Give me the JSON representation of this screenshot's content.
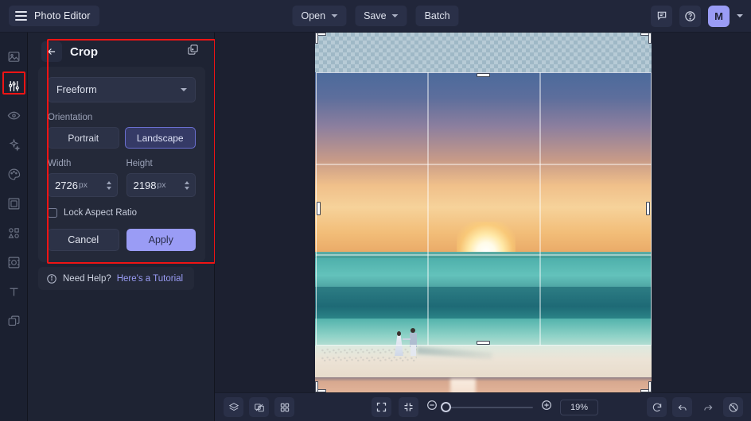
{
  "topbar": {
    "menu_icon": "hamburger-icon",
    "app_title": "Photo Editor",
    "open_label": "Open",
    "save_label": "Save",
    "batch_label": "Batch",
    "feedback_icon": "comment-icon",
    "help_icon": "question-circle-icon",
    "avatar_initial": "M",
    "avatar_caret_icon": "chevron-down-icon"
  },
  "rail": {
    "items": [
      {
        "name": "sidebar-item-image",
        "icon": "image-icon",
        "selected": false
      },
      {
        "name": "sidebar-item-adjust",
        "icon": "sliders-icon",
        "selected": true
      },
      {
        "name": "sidebar-item-retouch",
        "icon": "eye-icon",
        "selected": false
      },
      {
        "name": "sidebar-item-effects",
        "icon": "sparkles-icon",
        "selected": false
      },
      {
        "name": "sidebar-item-color",
        "icon": "palette-icon",
        "selected": false
      },
      {
        "name": "sidebar-item-frame",
        "icon": "frame-icon",
        "selected": false
      },
      {
        "name": "sidebar-item-shapes",
        "icon": "shapes-icon",
        "selected": false
      },
      {
        "name": "sidebar-item-focus",
        "icon": "focus-icon",
        "selected": false
      },
      {
        "name": "sidebar-item-text",
        "icon": "text-icon",
        "selected": false
      },
      {
        "name": "sidebar-item-layers",
        "icon": "layers-icon",
        "selected": false
      }
    ]
  },
  "panel": {
    "back_icon": "arrow-left-icon",
    "title": "Crop",
    "duplicate_icon": "duplicate-icon",
    "ratio_value": "Freeform",
    "ratio_caret_icon": "chevron-down-icon",
    "orientation_label": "Orientation",
    "orientation_portrait": "Portrait",
    "orientation_landscape": "Landscape",
    "orientation_selected": "Landscape",
    "width_label": "Width",
    "width_value": "2726",
    "width_unit": "px",
    "height_label": "Height",
    "height_value": "2198",
    "height_unit": "px",
    "lock_label": "Lock Aspect Ratio",
    "lock_checked": false,
    "cancel_label": "Cancel",
    "apply_label": "Apply",
    "help_icon": "info-icon",
    "help_text": "Need Help?",
    "help_link": "Here's a Tutorial"
  },
  "bottombar": {
    "layers_icon": "layers-stack-icon",
    "compare_icon": "compare-icon",
    "grid_icon": "grid-icon",
    "fit_icon": "fit-screen-icon",
    "fullscreen_icon": "collapse-icon",
    "zoom_out_icon": "zoom-out-icon",
    "zoom_in_icon": "zoom-in-icon",
    "zoom_value": "19%",
    "reset_icon": "reset-icon",
    "undo_icon": "undo-icon",
    "redo_icon": "redo-icon",
    "history_icon": "history-icon"
  },
  "canvas": {
    "image_description": "sunset-beach-photo",
    "crop_grid": "rule-of-thirds",
    "transparency_checker": true
  },
  "annotations": {
    "highlight_color": "#f01414",
    "boxes": [
      "sidebar-item-adjust",
      "crop-panel"
    ]
  }
}
